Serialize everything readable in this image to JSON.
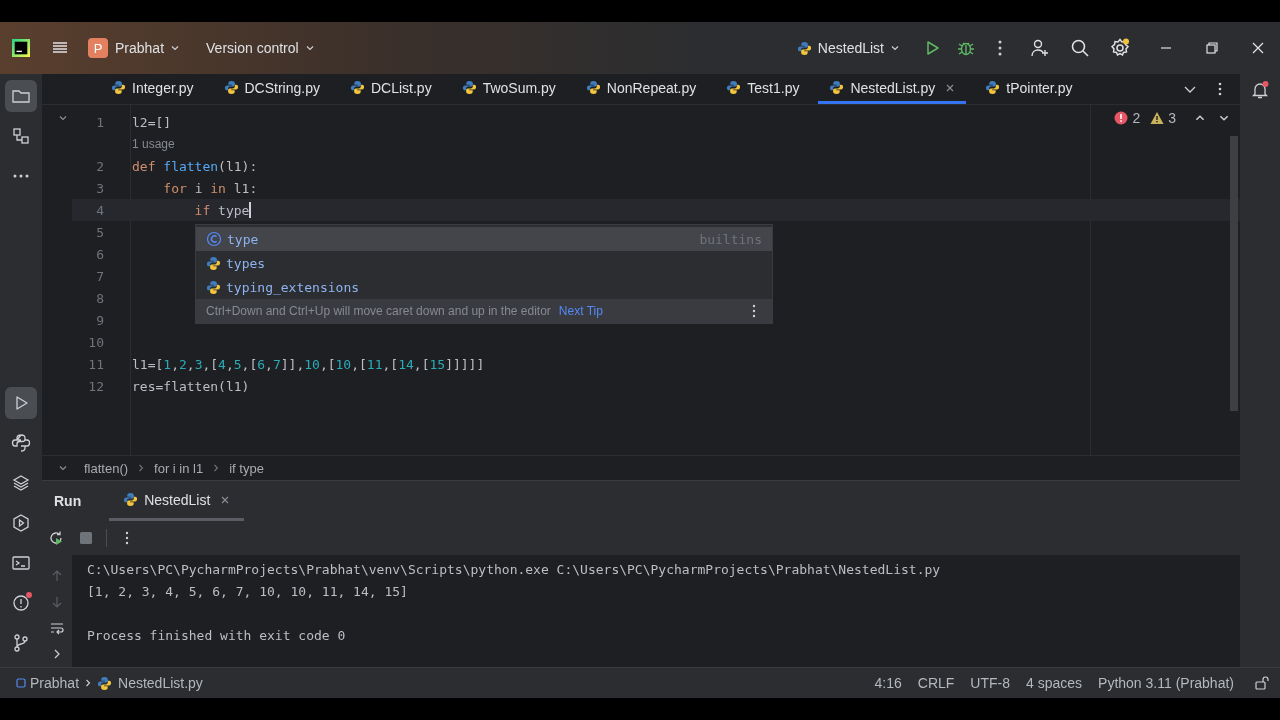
{
  "title_bar": {
    "project_initial": "P",
    "project": "Prabhat",
    "vcs": "Version control",
    "run_config": "NestedList"
  },
  "left_toolbar": {
    "top": [
      {
        "kind": "folder",
        "selected": true,
        "alert": false
      },
      {
        "kind": "structure",
        "selected": false,
        "alert": false
      },
      {
        "kind": "more",
        "selected": false,
        "alert": false
      }
    ],
    "bottom": [
      {
        "kind": "run",
        "selected": true,
        "alert": false
      },
      {
        "kind": "console",
        "selected": false,
        "alert": false
      },
      {
        "kind": "layers",
        "selected": false,
        "alert": false
      },
      {
        "kind": "services",
        "selected": false,
        "alert": false
      },
      {
        "kind": "terminal",
        "selected": false,
        "alert": false
      },
      {
        "kind": "problems",
        "selected": false,
        "alert": true
      },
      {
        "kind": "git",
        "selected": false,
        "alert": false
      }
    ]
  },
  "tabs": [
    {
      "label": "Integer.py",
      "selected": false
    },
    {
      "label": "DCString.py",
      "selected": false
    },
    {
      "label": "DCList.py",
      "selected": false
    },
    {
      "label": "TwoSum.py",
      "selected": false
    },
    {
      "label": "NonRepeat.py",
      "selected": false
    },
    {
      "label": "Test1.py",
      "selected": false
    },
    {
      "label": "NestedList.py",
      "selected": true
    },
    {
      "label": "tPointer.py",
      "selected": false
    }
  ],
  "editor": {
    "errors": "2",
    "warnings": "3",
    "lines": [
      {
        "kind": "code",
        "number": "1",
        "current": false,
        "tokens": [
          {
            "text": "l2=[]",
            "kind": "plain"
          }
        ]
      },
      {
        "kind": "hint",
        "text": "1 usage"
      },
      {
        "kind": "code",
        "number": "2",
        "current": false,
        "tokens": [
          {
            "text": "def ",
            "kind": "keyword"
          },
          {
            "text": "flatten",
            "kind": "call"
          },
          {
            "text": "(l1):",
            "kind": "plain"
          }
        ]
      },
      {
        "kind": "code",
        "number": "3",
        "current": false,
        "tokens": [
          {
            "text": "    for ",
            "kind": "keyword"
          },
          {
            "text": "i ",
            "kind": "plain"
          },
          {
            "text": "in ",
            "kind": "keyword"
          },
          {
            "text": "l1:",
            "kind": "plain"
          }
        ]
      },
      {
        "kind": "code",
        "number": "4",
        "current": true,
        "tokens": [
          {
            "text": "        if ",
            "kind": "keyword"
          },
          {
            "text": "type",
            "kind": "plain"
          }
        ]
      },
      {
        "kind": "code",
        "number": "5",
        "current": false
      },
      {
        "kind": "code",
        "number": "6",
        "current": false
      },
      {
        "kind": "code",
        "number": "7",
        "current": false
      },
      {
        "kind": "code",
        "number": "8",
        "current": false
      },
      {
        "kind": "code",
        "number": "9",
        "current": false
      },
      {
        "kind": "code",
        "number": "10",
        "current": false
      },
      {
        "kind": "code",
        "number": "11",
        "current": false,
        "tokens": [
          {
            "text": "l1=[",
            "kind": "plain"
          },
          {
            "text": "1",
            "kind": "number"
          },
          {
            "text": ",",
            "kind": "plain"
          },
          {
            "text": "2",
            "kind": "number"
          },
          {
            "text": ",",
            "kind": "plain"
          },
          {
            "text": "3",
            "kind": "number"
          },
          {
            "text": ",[",
            "kind": "plain"
          },
          {
            "text": "4",
            "kind": "number"
          },
          {
            "text": ",",
            "kind": "plain"
          },
          {
            "text": "5",
            "kind": "number"
          },
          {
            "text": ",[",
            "kind": "plain"
          },
          {
            "text": "6",
            "kind": "number"
          },
          {
            "text": ",",
            "kind": "plain"
          },
          {
            "text": "7",
            "kind": "number"
          },
          {
            "text": "]],",
            "kind": "plain"
          },
          {
            "text": "10",
            "kind": "number"
          },
          {
            "text": ",[",
            "kind": "plain"
          },
          {
            "text": "10",
            "kind": "number"
          },
          {
            "text": ",[",
            "kind": "plain"
          },
          {
            "text": "11",
            "kind": "number"
          },
          {
            "text": ",[",
            "kind": "plain"
          },
          {
            "text": "14",
            "kind": "number"
          },
          {
            "text": ",[",
            "kind": "plain"
          },
          {
            "text": "15",
            "kind": "number"
          },
          {
            "text": "]]]]]",
            "kind": "plain"
          }
        ]
      },
      {
        "kind": "code",
        "number": "12",
        "current": false,
        "tokens": [
          {
            "text": "res=flatten(l1)",
            "kind": "plain"
          }
        ]
      }
    ]
  },
  "completion": {
    "items": [
      {
        "kind": "class",
        "label": "type",
        "hint": "builtins",
        "selected": true
      },
      {
        "kind": "module",
        "label": "types",
        "selected": false
      },
      {
        "kind": "module",
        "label": "typing_extensions",
        "selected": false
      }
    ],
    "tip": "Ctrl+Down and Ctrl+Up will move caret down and up in the editor",
    "tip_link": "Next Tip"
  },
  "breadcrumbs": [
    "flatten()",
    "for i in l1",
    "if type"
  ],
  "run_panel": {
    "title": "Run",
    "tabs": [
      {
        "label": "NestedList",
        "selected": true
      }
    ],
    "console": [
      {
        "kind": "command",
        "text": "C:\\Users\\PC\\PycharmProjects\\Prabhat\\venv\\Scripts\\python.exe C:\\Users\\PC\\PycharmProjects\\Prabhat\\NestedList.py"
      },
      {
        "kind": "output",
        "text": "[1, 2, 3, 4, 5, 6, 7, 10, 10, 11, 14, 15]"
      },
      {
        "kind": "status",
        "text": "Process finished with exit code 0"
      }
    ]
  },
  "status_bar": {
    "path": [
      "Prabhat",
      "NestedList.py"
    ],
    "items": [
      "4:16",
      "CRLF",
      "UTF-8",
      "4 spaces",
      "Python 3.11 (Prabhat)"
    ]
  }
}
